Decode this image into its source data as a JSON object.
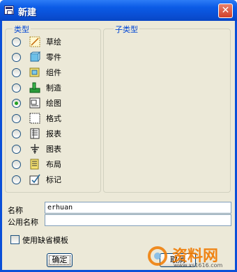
{
  "window": {
    "title": "新建",
    "close_label": "✕"
  },
  "type_group": {
    "legend": "类型",
    "options": [
      {
        "label": "草绘",
        "icon": "sketch-icon",
        "checked": false
      },
      {
        "label": "零件",
        "icon": "part-icon",
        "checked": false
      },
      {
        "label": "组件",
        "icon": "assembly-icon",
        "checked": false
      },
      {
        "label": "制造",
        "icon": "manufacturing-icon",
        "checked": false
      },
      {
        "label": "绘图",
        "icon": "drawing-icon",
        "checked": true
      },
      {
        "label": "格式",
        "icon": "format-icon",
        "checked": false
      },
      {
        "label": "报表",
        "icon": "report-icon",
        "checked": false
      },
      {
        "label": "图表",
        "icon": "diagram-icon",
        "checked": false
      },
      {
        "label": "布局",
        "icon": "layout-icon",
        "checked": false
      },
      {
        "label": "标记",
        "icon": "markup-icon",
        "checked": false
      }
    ]
  },
  "subtype_group": {
    "legend": "子类型"
  },
  "name_field": {
    "label": "名称",
    "value": "erhuan"
  },
  "common_name_field": {
    "label": "公用名称",
    "value": ""
  },
  "default_template": {
    "label": "使用缺省模板",
    "checked": false
  },
  "buttons": {
    "ok": "确定",
    "cancel": "取消"
  },
  "watermark": {
    "brand": "资料网",
    "url": "www.xs1616.com"
  },
  "colors": {
    "title_bar": "#0a50d6",
    "dialog_bg": "#ece9d8",
    "legend": "#0046d5",
    "watermark": "#f07a00"
  }
}
